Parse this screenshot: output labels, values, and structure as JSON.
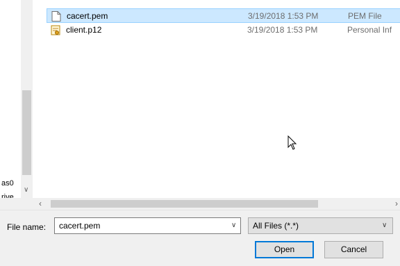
{
  "nav_pane": {
    "items": [
      {
        "label": "as0"
      },
      {
        "label": "rive"
      }
    ]
  },
  "files": [
    {
      "name": "cacert.pem",
      "date": "3/19/2018 1:53 PM",
      "type": "PEM File",
      "icon": "document-icon",
      "selected": true
    },
    {
      "name": "client.p12",
      "date": "3/19/2018 1:53 PM",
      "type": "Personal Inf",
      "icon": "certificate-icon",
      "selected": false
    }
  ],
  "footer": {
    "file_name_label": "File name:",
    "file_name_value": "cacert.pem",
    "file_type_value": "All Files (*.*)",
    "open_label": "Open",
    "cancel_label": "Cancel"
  },
  "colors": {
    "selection": "#cce8ff",
    "selection_border": "#99d1ff",
    "accent": "#0078d7"
  }
}
